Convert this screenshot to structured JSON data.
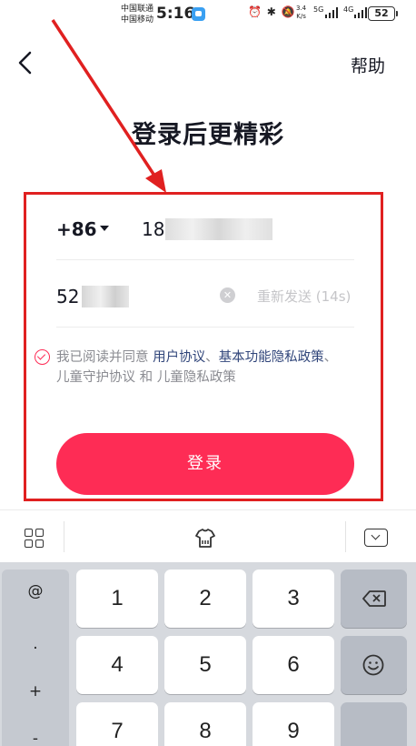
{
  "status_bar": {
    "carrier_1": "中国联通",
    "carrier_2": "中国移动",
    "time": "5:16",
    "net_speed_value": "3.4",
    "net_speed_unit": "K/s",
    "sim1_type": "5G",
    "sim2_type": "4G",
    "battery": "52",
    "icons": [
      "app-notification-icon",
      "alarm-icon",
      "bluetooth-icon",
      "mute-icon",
      "signal-icon",
      "battery-icon"
    ]
  },
  "header": {
    "back_icon": "chevron-left-icon",
    "help_label": "帮助",
    "title": "登录后更精彩"
  },
  "form": {
    "country_code": "+86",
    "phone_value": "18",
    "code_value": "52",
    "resend_label": "重新发送 (14s)",
    "agreement": {
      "prefix": "我已阅读并同意 ",
      "user_agreement": "用户协议",
      "sep1": "、",
      "basic_privacy": "基本功能隐私政策",
      "sep2": "、",
      "child_protection": "儿童守护协议",
      "and": " 和 ",
      "child_privacy": "儿童隐私政策",
      "checked": true
    },
    "login_label": "登录"
  },
  "keyboard": {
    "symbols": [
      "@",
      ".",
      "+",
      "-"
    ],
    "keys": [
      "1",
      "2",
      "3",
      "4",
      "5",
      "6",
      "7",
      "8",
      "9"
    ],
    "toolbar_icons": [
      "grid-menu-icon",
      "keyboard-skin-icon",
      "hide-keyboard-icon"
    ],
    "function_icons": [
      "backspace-icon",
      "emoji-icon"
    ]
  },
  "colors": {
    "accent": "#fe2c55",
    "link": "#30457a",
    "annotation": "#e02020"
  }
}
